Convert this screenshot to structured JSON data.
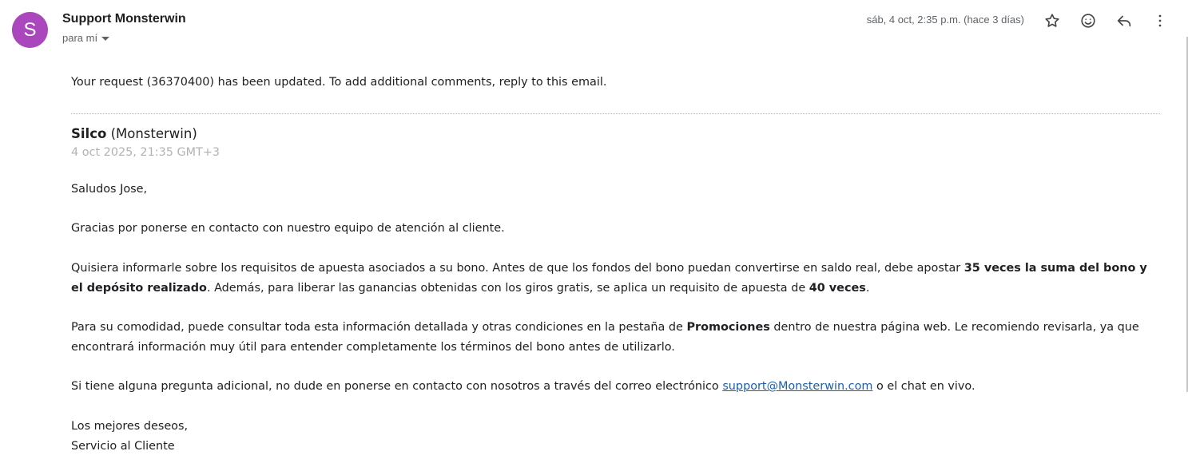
{
  "header": {
    "avatar_letter": "S",
    "sender": "Support Monsterwin",
    "recipient": "para mí",
    "date": "sáb, 4 oct, 2:35 p.m. (hace 3 días)",
    "icons": [
      "star-icon",
      "emoji-icon",
      "reply-icon",
      "more-vert-icon"
    ]
  },
  "message": {
    "request_line": "Your request (36370400) has been updated. To add additional comments, reply to this email.",
    "agent_name": "Silco",
    "agent_org": "(Monsterwin)",
    "agent_date": "4 oct 2025, 21:35 GMT+3",
    "greeting": "Saludos Jose,",
    "thanks": "Gracias por ponerse en contacto con nuestro equipo de atención al cliente.",
    "p3_a": "Quisiera informarle sobre los requisitos de apuesta asociados a su bono. Antes de que los fondos del bono puedan convertirse en saldo real, debe apostar ",
    "p3_b": "35 veces la suma del bono y el depósito realizado",
    "p3_c": ". Además, para liberar las ganancias obtenidas con los giros gratis, se aplica un requisito de apuesta de ",
    "p3_d": "40 veces",
    "p3_e": ".",
    "p4_a": "Para su comodidad, puede consultar toda esta información detallada y otras condiciones en la pestaña de ",
    "p4_b": "Promociones",
    "p4_c": " dentro de nuestra página web. Le recomiendo revisarla, ya que encontrará información muy útil para entender completamente los términos del bono antes de utilizarlo.",
    "p5_a": "Si tiene alguna pregunta adicional, no dude en ponerse en contacto con nosotros a través del correo electrónico ",
    "p5_link": "support@Monsterwin.com",
    "p5_b": " o el chat en vivo.",
    "closing": "Los mejores deseos,",
    "signature": "Servicio al Cliente"
  }
}
